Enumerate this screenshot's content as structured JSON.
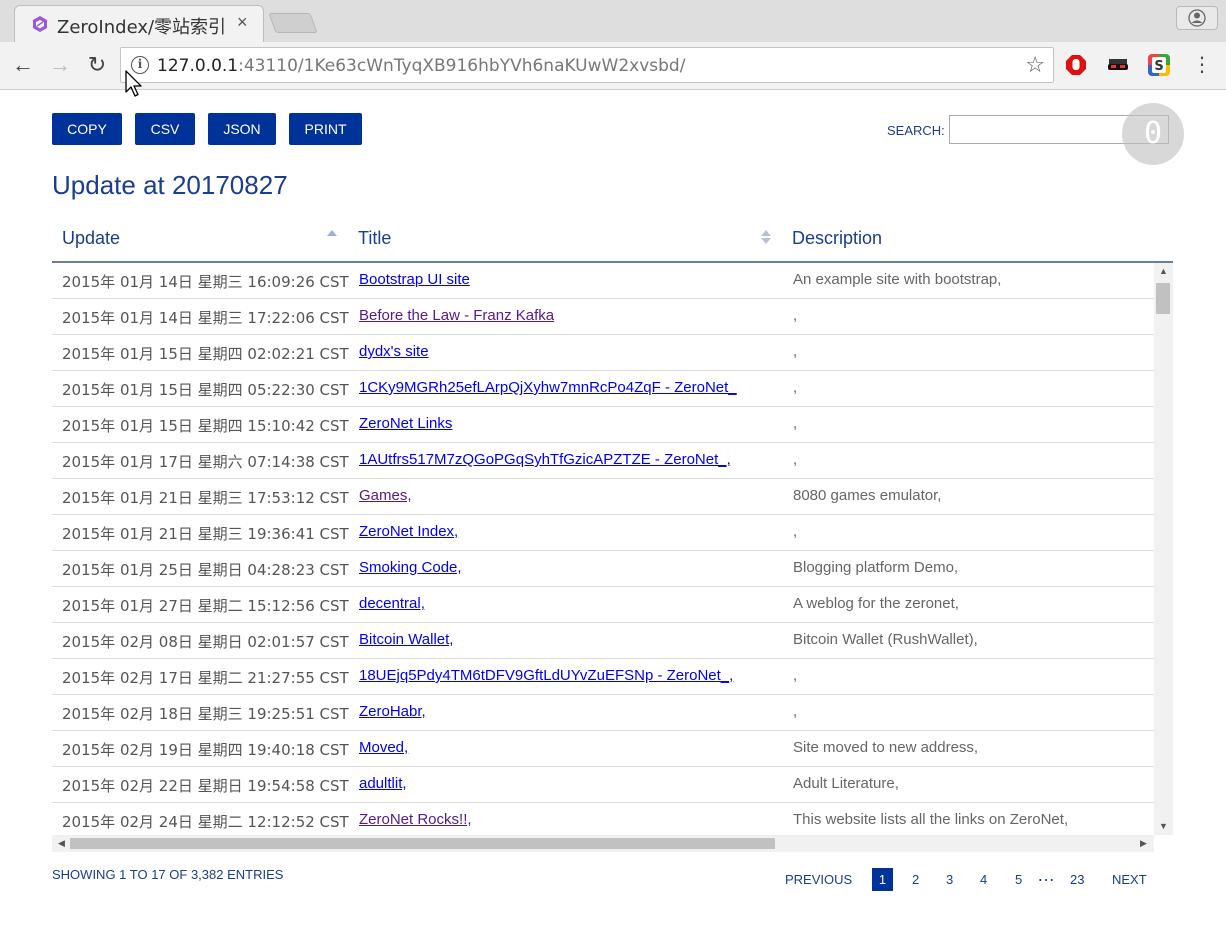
{
  "browser": {
    "tab_title": "ZeroIndex/零站索引",
    "url_host": "127.0.0.1",
    "url_rest": ":43110/1Ke63cWnTyqXB916hbYVh6naKUwW2xvsbd/"
  },
  "toolbar": {
    "copy": "COPY",
    "csv": "CSV",
    "json": "JSON",
    "print": "PRINT"
  },
  "search": {
    "label": "SEARCH:",
    "value": ""
  },
  "badge": "0",
  "page_title": "Update at 20170827",
  "table": {
    "columns": [
      "Update",
      "Title",
      "Description"
    ],
    "rows": [
      {
        "update": "2015年 01月 14日 星期三 16:09:26 CST",
        "title": "Bootstrap UI site",
        "desc": "An example site with bootstrap,",
        "visited": false
      },
      {
        "update": "2015年 01月 14日 星期三 17:22:06 CST",
        "title": "Before the Law - Franz Kafka",
        "desc": ",",
        "visited": true
      },
      {
        "update": "2015年 01月 15日 星期四 02:02:21 CST",
        "title": "dydx's site",
        "desc": ",",
        "visited": false
      },
      {
        "update": "2015年 01月 15日 星期四 05:22:30 CST",
        "title": "1CKy9MGRh25efLArpQjXyhw7mnRcPo4ZqF - ZeroNet_",
        "desc": ",",
        "visited": false
      },
      {
        "update": "2015年 01月 15日 星期四 15:10:42 CST",
        "title": "ZeroNet Links",
        "desc": ",",
        "visited": false
      },
      {
        "update": "2015年 01月 17日 星期六 07:14:38 CST",
        "title": "1AUtfrs517M7zQGoPGqSyhTfGzicAPZTZE - ZeroNet_,",
        "desc": ",",
        "visited": false
      },
      {
        "update": "2015年 01月 21日 星期三 17:53:12 CST",
        "title": "Games,",
        "desc": "8080 games emulator,",
        "visited": true
      },
      {
        "update": "2015年 01月 21日 星期三 19:36:41 CST",
        "title": "ZeroNet Index,",
        "desc": ",",
        "visited": false
      },
      {
        "update": "2015年 01月 25日 星期日 04:28:23 CST",
        "title": "Smoking Code,",
        "desc": "Blogging platform Demo,",
        "visited": false
      },
      {
        "update": "2015年 01月 27日 星期二 15:12:56 CST",
        "title": "decentral,",
        "desc": "A weblog for the zeronet,",
        "visited": false
      },
      {
        "update": "2015年 02月 08日 星期日 02:01:57 CST",
        "title": "Bitcoin Wallet,",
        "desc": "Bitcoin Wallet (RushWallet),",
        "visited": false
      },
      {
        "update": "2015年 02月 17日 星期二 21:27:55 CST",
        "title": "18UEjq5Pdy4TM6tDFV9GftLdUYvZuEFSNp - ZeroNet_,",
        "desc": ",",
        "visited": false
      },
      {
        "update": "2015年 02月 18日 星期三 19:25:51 CST",
        "title": "ZeroHabr,",
        "desc": ",",
        "visited": false
      },
      {
        "update": "2015年 02月 19日 星期四 19:40:18 CST",
        "title": "Moved,",
        "desc": "Site moved to new address,",
        "visited": false
      },
      {
        "update": "2015年 02月 22日 星期日 19:54:58 CST",
        "title": "adultlit,",
        "desc": "Adult Literature,",
        "visited": false
      },
      {
        "update": "2015年 02月 24日 星期二 12:12:52 CST",
        "title": "ZeroNet Rocks!!,",
        "desc": "This website lists all the links on ZeroNet,",
        "visited": true
      }
    ]
  },
  "footer": {
    "info": "SHOWING 1 TO 17 OF 3,382 ENTRIES",
    "previous": "PREVIOUS",
    "pages": [
      "1",
      "2",
      "3",
      "4",
      "5"
    ],
    "ellipsis": "…",
    "last": "23",
    "next": "NEXT"
  },
  "colors": {
    "accent": "#003399",
    "link": "#0000ee",
    "visited": "#551a8b",
    "heading": "#1a3d8f"
  }
}
